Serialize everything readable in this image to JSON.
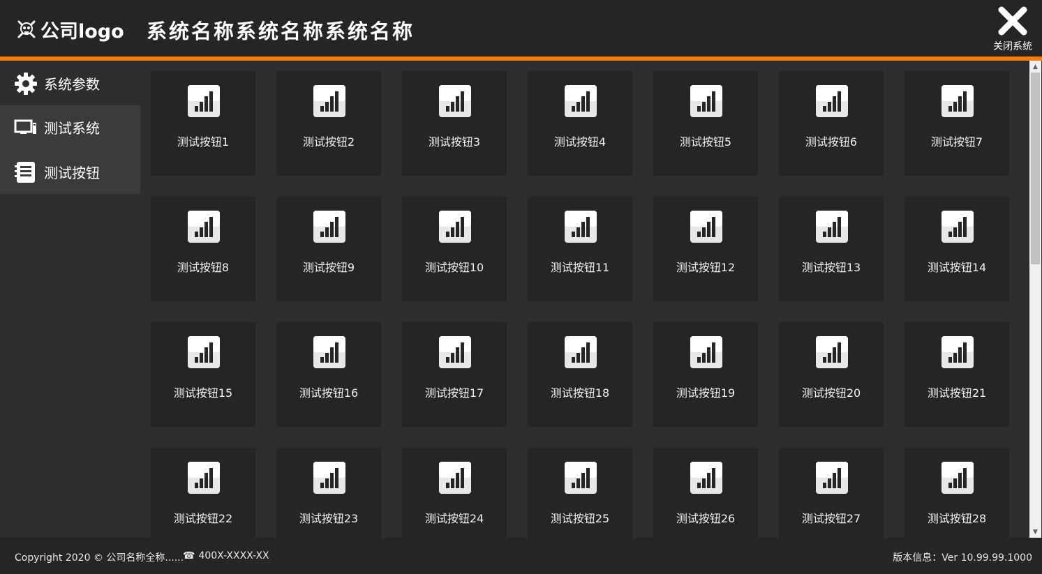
{
  "header": {
    "brand_logo_text": "公司logo",
    "brand_icon": "skull-crossbones-icon",
    "system_title": "系统名称系统名称系统名称",
    "close_label": "关闭系统",
    "accent_color": "#ff7a00"
  },
  "sidebar": {
    "items": [
      {
        "label": "系统参数",
        "icon": "gear-icon",
        "active": false
      },
      {
        "label": "测试系统",
        "icon": "monitor-icon",
        "active": true
      },
      {
        "label": "测试按钮",
        "icon": "notebook-icon",
        "active": true
      }
    ]
  },
  "tiles": {
    "icon": "bar-chart-icon",
    "labels": [
      "测试按钮1",
      "测试按钮2",
      "测试按钮3",
      "测试按钮4",
      "测试按钮5",
      "测试按钮6",
      "测试按钮7",
      "测试按钮8",
      "测试按钮9",
      "测试按钮10",
      "测试按钮11",
      "测试按钮12",
      "测试按钮13",
      "测试按钮14",
      "测试按钮15",
      "测试按钮16",
      "测试按钮17",
      "测试按钮18",
      "测试按钮19",
      "测试按钮20",
      "测试按钮21",
      "测试按钮22",
      "测试按钮23",
      "测试按钮24",
      "测试按钮25",
      "测试按钮26",
      "测试按钮27",
      "测试按钮28"
    ]
  },
  "footer": {
    "copyright": "Copyright 2020 © 公司名称全称......",
    "phone": "400X-XXXX-XX",
    "phone_icon": "telephone-icon",
    "version": "版本信息：Ver 10.99.99.1000"
  }
}
